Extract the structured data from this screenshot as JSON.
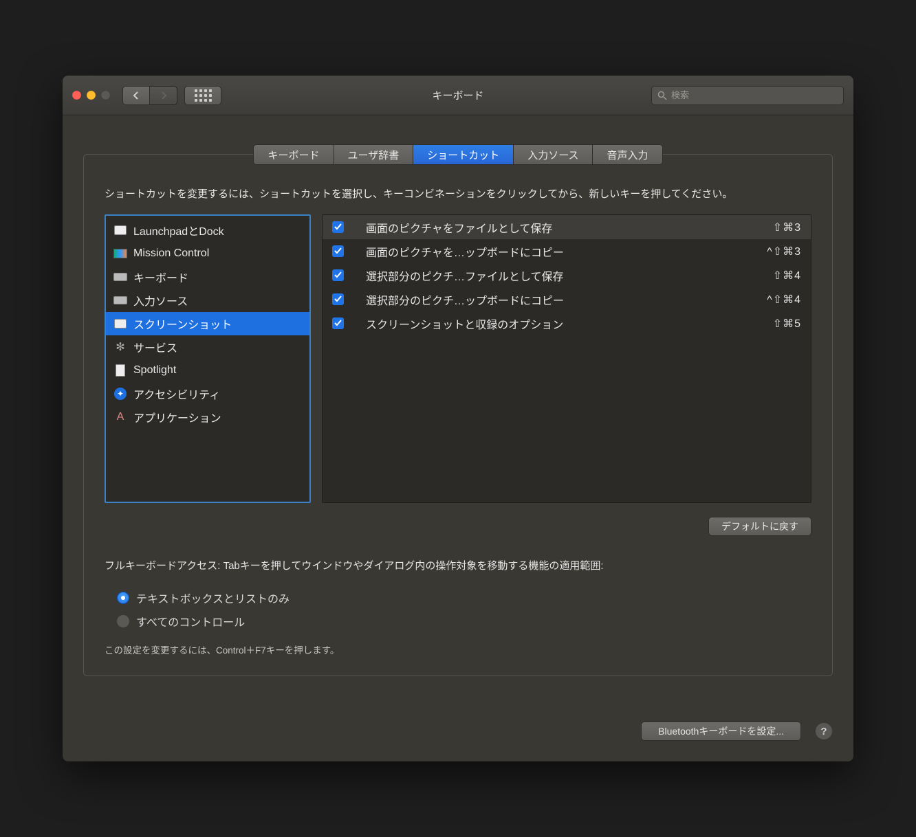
{
  "window": {
    "title": "キーボード",
    "search_placeholder": "検索"
  },
  "tabs": [
    {
      "label": "キーボード"
    },
    {
      "label": "ユーザ辞書"
    },
    {
      "label": "ショートカット",
      "active": true
    },
    {
      "label": "入力ソース"
    },
    {
      "label": "音声入力"
    }
  ],
  "instruction": "ショートカットを変更するには、ショートカットを選択し、キーコンビネーションをクリックしてから、新しいキーを押してください。",
  "categories": [
    {
      "label": "LaunchpadとDock",
      "icon": "launchpad"
    },
    {
      "label": "Mission Control",
      "icon": "mission-control"
    },
    {
      "label": "キーボード",
      "icon": "keyboard"
    },
    {
      "label": "入力ソース",
      "icon": "keyboard"
    },
    {
      "label": "スクリーンショット",
      "icon": "screenshot",
      "selected": true
    },
    {
      "label": "サービス",
      "icon": "gear"
    },
    {
      "label": "Spotlight",
      "icon": "doc"
    },
    {
      "label": "アクセシビリティ",
      "icon": "accessibility"
    },
    {
      "label": "アプリケーション",
      "icon": "app"
    }
  ],
  "shortcuts": [
    {
      "label": "画面のピクチャをファイルとして保存",
      "keys": "⇧⌘3",
      "checked": true,
      "highlight": true
    },
    {
      "label": "画面のピクチャを…ップボードにコピー",
      "keys": "^⇧⌘3",
      "checked": true
    },
    {
      "label": "選択部分のピクチ…ファイルとして保存",
      "keys": "⇧⌘4",
      "checked": true
    },
    {
      "label": "選択部分のピクチ…ップボードにコピー",
      "keys": "^⇧⌘4",
      "checked": true
    },
    {
      "label": "スクリーンショットと収録のオプション",
      "keys": "⇧⌘5",
      "checked": true
    }
  ],
  "defaults_label": "デフォルトに戻す",
  "fk_description": "フルキーボードアクセス: Tabキーを押してウインドウやダイアログ内の操作対象を移動する機能の適用範囲:",
  "radios": [
    {
      "label": "テキストボックスとリストのみ",
      "on": true
    },
    {
      "label": "すべてのコントロール",
      "on": false
    }
  ],
  "hint": "この設定を変更するには、Control＋F7キーを押します。",
  "bluetooth_label": "Bluetoothキーボードを設定...",
  "help_label": "?"
}
